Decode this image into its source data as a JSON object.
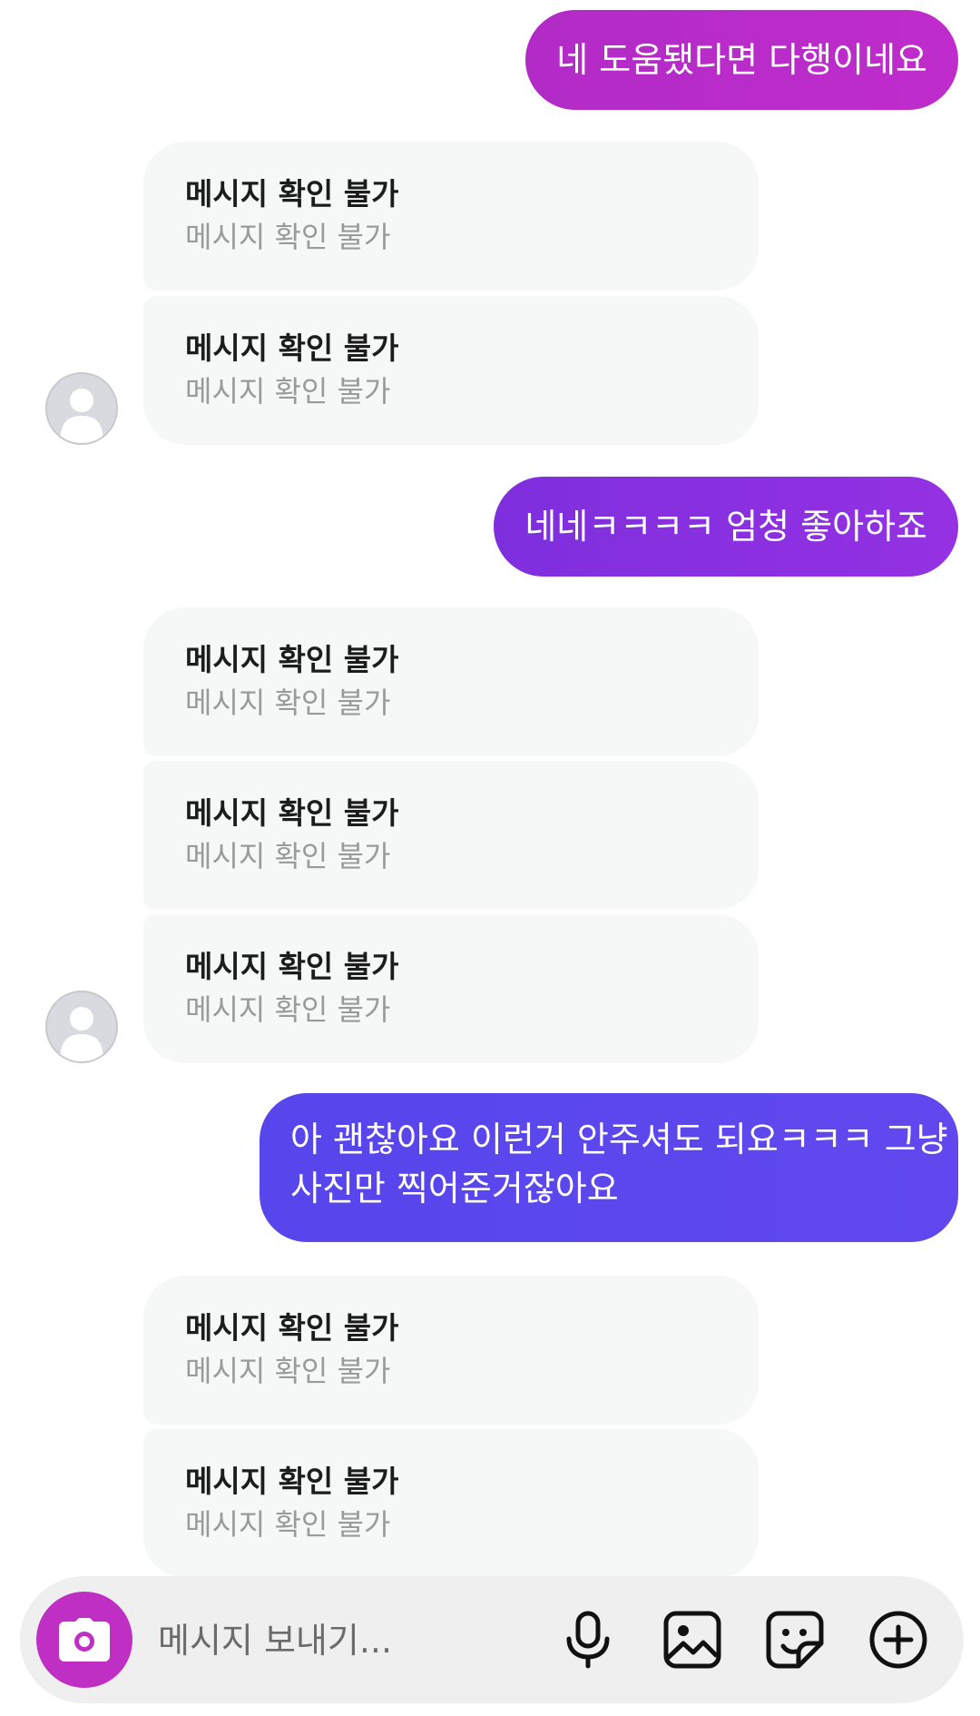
{
  "messages": {
    "sent_1": "네 도움됐다면 다행이네요",
    "sent_2": "네네ㅋㅋㅋㅋ 엄청 좋아하죠",
    "sent_3_line1": "아 괜찮아요 이런거 안주셔도 되요ㅋㅋㅋ 그냥",
    "sent_3_line2": "사진만 찍어준거잖아요",
    "unavailable_title": "메시지 확인 불가",
    "unavailable_sub": "메시지 확인 불가"
  },
  "composer": {
    "placeholder": "메시지 보내기..."
  },
  "icons": {
    "camera": "camera-icon",
    "microphone": "microphone-icon",
    "gallery": "gallery-icon",
    "sticker": "sticker-icon",
    "add": "plus-circle-icon",
    "avatar": "default-avatar-icon"
  },
  "colors": {
    "sent_1": "#b52bc8",
    "sent_2": "#8a2fdf",
    "sent_3": "#5b48ec",
    "camera_button": "#c02fc4",
    "received_bubble": "#f6f7f7"
  }
}
